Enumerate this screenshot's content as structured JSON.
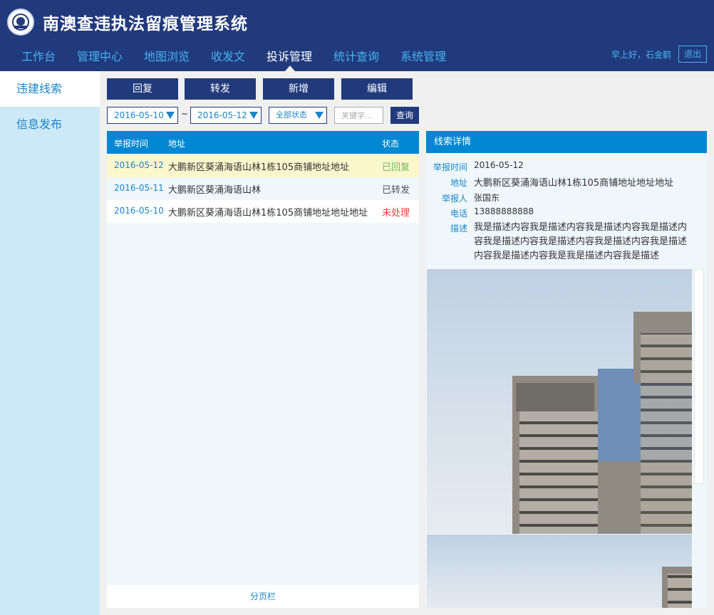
{
  "header": {
    "title": "南澳查违执法留痕管理系统",
    "greeting": "早上好，石金鹤",
    "logout": "退出"
  },
  "nav": [
    {
      "label": "工作台"
    },
    {
      "label": "管理中心"
    },
    {
      "label": "地图浏览"
    },
    {
      "label": "收发文"
    },
    {
      "label": "投诉管理",
      "active": true
    },
    {
      "label": "统计查询"
    },
    {
      "label": "系统管理"
    }
  ],
  "sidebar": [
    {
      "label": "违建线索",
      "active": true
    },
    {
      "label": "信息发布"
    }
  ],
  "toolbar": {
    "reply": "回复",
    "forward": "转发",
    "add": "新增",
    "edit": "编辑"
  },
  "filter": {
    "date_from": "2016-05-10",
    "tilde": "~",
    "date_to": "2016-05-12",
    "status": "全部状态",
    "keyword_placeholder": "关键字...",
    "query": "查询"
  },
  "list": {
    "columns": [
      "举报时间",
      "地址",
      "状态"
    ],
    "rows": [
      {
        "date": "2016-05-12",
        "address": "大鹏新区葵涌海语山林1栋105商铺地址地址",
        "status": "已回复",
        "status_color": "#6cbb5a",
        "bg": "#fcf6cd"
      },
      {
        "date": "2016-05-11",
        "address": "大鹏新区葵涌海语山林",
        "status": "已转发",
        "status_color": "#555555",
        "bg": "#eff7fb"
      },
      {
        "date": "2016-05-10",
        "address": "大鹏新区葵涌海语山林1栋105商铺地址地址地址",
        "status": "未处理",
        "status_color": "#e8403a",
        "bg": "#ffffff"
      }
    ],
    "pager": "分页栏"
  },
  "detail": {
    "title": "线索详情",
    "report_time_label": "举报时间",
    "report_time": "2016-05-12",
    "address_label": "地址",
    "address": "大鹏新区葵涌海语山林1栋105商铺地址地址地址",
    "reporter_label": "举报人",
    "reporter": "张国东",
    "phone_label": "电话",
    "phone": "13888888888",
    "desc_label": "描述",
    "desc": "我是描述内容我是描述内容我是描述内容我是描述内容我是描述内容我是描述内容我是描述内容我是描述内容我是描述内容我是我是描述内容我是描述"
  },
  "colors": {
    "header_bg": "#213a7c",
    "accent": "#0087d1",
    "link": "#1986c8",
    "sidebar_bg": "#cde8f7"
  }
}
